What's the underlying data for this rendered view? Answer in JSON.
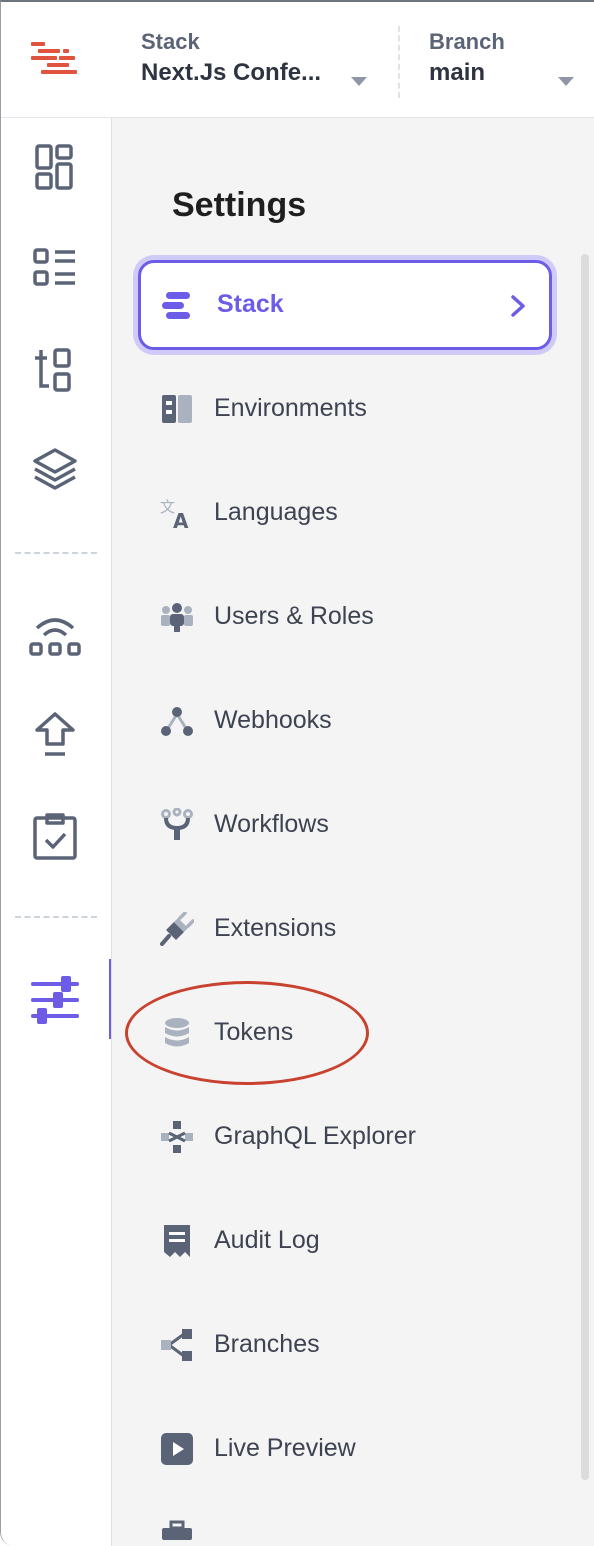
{
  "header": {
    "stack_label": "Stack",
    "stack_value": "Next.Js Confe...",
    "branch_label": "Branch",
    "branch_value": "main"
  },
  "rail": {
    "icons": [
      "dashboard-icon",
      "entries-list-icon",
      "content-models-icon",
      "assets-stack-icon",
      "releases-network-icon",
      "deploy-upload-icon",
      "tasks-clipboard-icon",
      "settings-sliders-icon"
    ],
    "active": "settings-sliders-icon",
    "accent": "#6c5ce7"
  },
  "settings": {
    "title": "Settings",
    "items": [
      {
        "label": "Stack",
        "icon": "stack-icon",
        "active": true
      },
      {
        "label": "Environments",
        "icon": "environments-icon"
      },
      {
        "label": "Languages",
        "icon": "languages-icon"
      },
      {
        "label": "Users & Roles",
        "icon": "users-roles-icon"
      },
      {
        "label": "Webhooks",
        "icon": "webhooks-icon"
      },
      {
        "label": "Workflows",
        "icon": "workflows-icon"
      },
      {
        "label": "Extensions",
        "icon": "extensions-plug-icon"
      },
      {
        "label": "Tokens",
        "icon": "tokens-database-icon",
        "annotated": true
      },
      {
        "label": "GraphQL Explorer",
        "icon": "graphql-icon"
      },
      {
        "label": "Audit Log",
        "icon": "audit-log-icon"
      },
      {
        "label": "Branches",
        "icon": "branches-icon"
      },
      {
        "label": "Live Preview",
        "icon": "live-preview-icon"
      }
    ]
  },
  "colors": {
    "accent": "#6c5ce7",
    "annotation": "#c9412f",
    "icon_gray": "#5b6477",
    "logo_red": "#e0533f"
  }
}
